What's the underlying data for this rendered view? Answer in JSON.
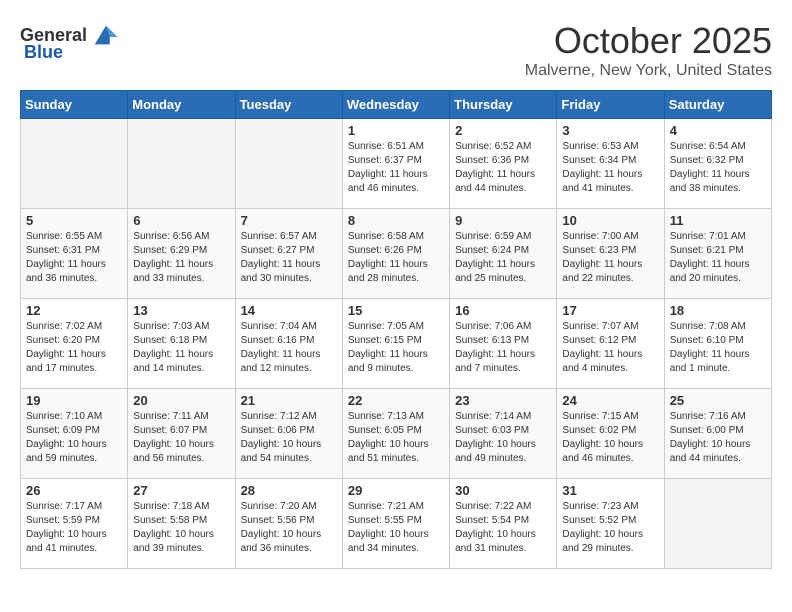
{
  "header": {
    "logo_general": "General",
    "logo_blue": "Blue",
    "month": "October 2025",
    "location": "Malverne, New York, United States"
  },
  "days_of_week": [
    "Sunday",
    "Monday",
    "Tuesday",
    "Wednesday",
    "Thursday",
    "Friday",
    "Saturday"
  ],
  "weeks": [
    [
      {
        "day": "",
        "info": ""
      },
      {
        "day": "",
        "info": ""
      },
      {
        "day": "",
        "info": ""
      },
      {
        "day": "1",
        "info": "Sunrise: 6:51 AM\nSunset: 6:37 PM\nDaylight: 11 hours\nand 46 minutes."
      },
      {
        "day": "2",
        "info": "Sunrise: 6:52 AM\nSunset: 6:36 PM\nDaylight: 11 hours\nand 44 minutes."
      },
      {
        "day": "3",
        "info": "Sunrise: 6:53 AM\nSunset: 6:34 PM\nDaylight: 11 hours\nand 41 minutes."
      },
      {
        "day": "4",
        "info": "Sunrise: 6:54 AM\nSunset: 6:32 PM\nDaylight: 11 hours\nand 38 minutes."
      }
    ],
    [
      {
        "day": "5",
        "info": "Sunrise: 6:55 AM\nSunset: 6:31 PM\nDaylight: 11 hours\nand 36 minutes."
      },
      {
        "day": "6",
        "info": "Sunrise: 6:56 AM\nSunset: 6:29 PM\nDaylight: 11 hours\nand 33 minutes."
      },
      {
        "day": "7",
        "info": "Sunrise: 6:57 AM\nSunset: 6:27 PM\nDaylight: 11 hours\nand 30 minutes."
      },
      {
        "day": "8",
        "info": "Sunrise: 6:58 AM\nSunset: 6:26 PM\nDaylight: 11 hours\nand 28 minutes."
      },
      {
        "day": "9",
        "info": "Sunrise: 6:59 AM\nSunset: 6:24 PM\nDaylight: 11 hours\nand 25 minutes."
      },
      {
        "day": "10",
        "info": "Sunrise: 7:00 AM\nSunset: 6:23 PM\nDaylight: 11 hours\nand 22 minutes."
      },
      {
        "day": "11",
        "info": "Sunrise: 7:01 AM\nSunset: 6:21 PM\nDaylight: 11 hours\nand 20 minutes."
      }
    ],
    [
      {
        "day": "12",
        "info": "Sunrise: 7:02 AM\nSunset: 6:20 PM\nDaylight: 11 hours\nand 17 minutes."
      },
      {
        "day": "13",
        "info": "Sunrise: 7:03 AM\nSunset: 6:18 PM\nDaylight: 11 hours\nand 14 minutes."
      },
      {
        "day": "14",
        "info": "Sunrise: 7:04 AM\nSunset: 6:16 PM\nDaylight: 11 hours\nand 12 minutes."
      },
      {
        "day": "15",
        "info": "Sunrise: 7:05 AM\nSunset: 6:15 PM\nDaylight: 11 hours\nand 9 minutes."
      },
      {
        "day": "16",
        "info": "Sunrise: 7:06 AM\nSunset: 6:13 PM\nDaylight: 11 hours\nand 7 minutes."
      },
      {
        "day": "17",
        "info": "Sunrise: 7:07 AM\nSunset: 6:12 PM\nDaylight: 11 hours\nand 4 minutes."
      },
      {
        "day": "18",
        "info": "Sunrise: 7:08 AM\nSunset: 6:10 PM\nDaylight: 11 hours\nand 1 minute."
      }
    ],
    [
      {
        "day": "19",
        "info": "Sunrise: 7:10 AM\nSunset: 6:09 PM\nDaylight: 10 hours\nand 59 minutes."
      },
      {
        "day": "20",
        "info": "Sunrise: 7:11 AM\nSunset: 6:07 PM\nDaylight: 10 hours\nand 56 minutes."
      },
      {
        "day": "21",
        "info": "Sunrise: 7:12 AM\nSunset: 6:06 PM\nDaylight: 10 hours\nand 54 minutes."
      },
      {
        "day": "22",
        "info": "Sunrise: 7:13 AM\nSunset: 6:05 PM\nDaylight: 10 hours\nand 51 minutes."
      },
      {
        "day": "23",
        "info": "Sunrise: 7:14 AM\nSunset: 6:03 PM\nDaylight: 10 hours\nand 49 minutes."
      },
      {
        "day": "24",
        "info": "Sunrise: 7:15 AM\nSunset: 6:02 PM\nDaylight: 10 hours\nand 46 minutes."
      },
      {
        "day": "25",
        "info": "Sunrise: 7:16 AM\nSunset: 6:00 PM\nDaylight: 10 hours\nand 44 minutes."
      }
    ],
    [
      {
        "day": "26",
        "info": "Sunrise: 7:17 AM\nSunset: 5:59 PM\nDaylight: 10 hours\nand 41 minutes."
      },
      {
        "day": "27",
        "info": "Sunrise: 7:18 AM\nSunset: 5:58 PM\nDaylight: 10 hours\nand 39 minutes."
      },
      {
        "day": "28",
        "info": "Sunrise: 7:20 AM\nSunset: 5:56 PM\nDaylight: 10 hours\nand 36 minutes."
      },
      {
        "day": "29",
        "info": "Sunrise: 7:21 AM\nSunset: 5:55 PM\nDaylight: 10 hours\nand 34 minutes."
      },
      {
        "day": "30",
        "info": "Sunrise: 7:22 AM\nSunset: 5:54 PM\nDaylight: 10 hours\nand 31 minutes."
      },
      {
        "day": "31",
        "info": "Sunrise: 7:23 AM\nSunset: 5:52 PM\nDaylight: 10 hours\nand 29 minutes."
      },
      {
        "day": "",
        "info": ""
      }
    ]
  ]
}
